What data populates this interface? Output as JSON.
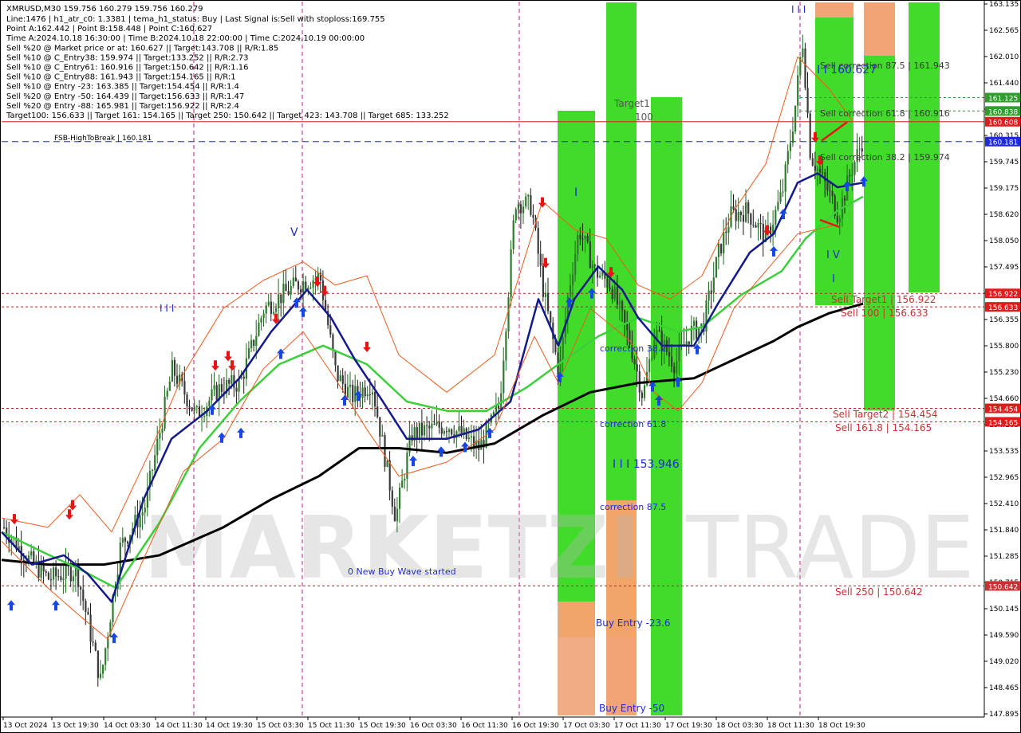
{
  "chart_data": {
    "type": "candlestick",
    "symbol_header": "XMRUSD,M30  159.756 160.279 159.756 160.279",
    "info_lines": [
      "Line:1476 | h1_atr_c0: 1.3381 | tema_h1_status: Buy | Last Signal is:Sell with stoploss:169.755",
      "Point A:162.442 | Point B:158.448 | Point C:160.627",
      "Time A:2024.10.18 16:30:00 | Time B:2024.10.18 22:00:00 | Time C:2024.10.19 00:00:00",
      "Sell %20 @ Market price or at: 160.627 || Target:143.708 || R/R:1.85",
      "Sell %10 @ C_Entry38: 159.974 || Target:133.252 || R/R:2.73",
      "Sell %10 @ C_Entry61: 160.916 || Target:150.642 || R/R:1.16",
      "Sell %10 @ C_Entry88: 161.943 || Target:154.165 || R/R:1",
      "Sell %10 @ Entry -23: 163.385 || Target:154.454 || R/R:1.4",
      "Sell %20 @ Entry -50: 164.439 || Target:156.633 || R/R:1.47",
      "Sell %20 @ Entry -88: 165.981 || Target:156.922 || R/R:2.4",
      "Target100: 156.633 || Target 161: 154.165 || Target 250: 150.642 || Target 423: 143.708 || Target 685: 133.252"
    ],
    "y_ticks": [
      "163.135",
      "162.565",
      "162.010",
      "161.440",
      "160.870",
      "160.315",
      "159.745",
      "159.175",
      "158.620",
      "158.050",
      "157.495",
      "156.925",
      "156.355",
      "155.800",
      "155.230",
      "154.660",
      "154.105",
      "153.535",
      "152.965",
      "152.410",
      "151.840",
      "151.285",
      "150.715",
      "150.145",
      "149.590",
      "149.020",
      "148.465",
      "147.895"
    ],
    "ylim": [
      147.895,
      163.135
    ],
    "x_ticks": [
      "13 Oct 2024",
      "13 Oct 19:30",
      "14 Oct 03:30",
      "14 Oct 11:30",
      "14 Oct 19:30",
      "15 Oct 03:30",
      "15 Oct 11:30",
      "15 Oct 19:30",
      "16 Oct 03:30",
      "16 Oct 11:30",
      "16 Oct 19:30",
      "17 Oct 03:30",
      "17 Oct 11:30",
      "17 Oct 19:30",
      "18 Oct 03:30",
      "18 Oct 11:30",
      "18 Oct 19:30"
    ],
    "price_labels": [
      {
        "text": "161.125",
        "value": 161.125,
        "color": "#2e9e2e"
      },
      {
        "text": "160.838",
        "value": 160.838,
        "color": "#2e9e2e"
      },
      {
        "text": "160.608",
        "value": 160.608,
        "color": "#e11b1b"
      },
      {
        "text": "160.181",
        "value": 160.181,
        "color": "#1f2ad8"
      },
      {
        "text": "156.922",
        "value": 156.922,
        "color": "#e11b1b"
      },
      {
        "text": "156.633",
        "value": 156.633,
        "color": "#e11b1b"
      },
      {
        "text": "154.454",
        "value": 154.454,
        "color": "#e11b1b"
      },
      {
        "text": "154.165",
        "value": 154.165,
        "color": "#e11b1b"
      },
      {
        "text": "150.642",
        "value": 150.642,
        "color": "#c83232"
      }
    ],
    "level_texts": {
      "fsb": "FSB-HighToBreak | 160.181",
      "corr875": "Sell correction 87.5 | 161.943",
      "corr618": "Sell correction 61.8 | 160.916",
      "corr382": "Sell correction 38.2 | 159.974",
      "target1": "Sell Target1 | 156.922",
      "sell100": "Sell 100 | 156.633",
      "target2": "Sell Target2 | 154.454",
      "sell1618": "Sell 161.8 | 154.165",
      "sell250": "Sell 250 | 150.642"
    },
    "annotations": {
      "wave_iii_label": "I I I",
      "wave_v": "V",
      "wave_i": "I",
      "wave_iv": "I V",
      "wave_b": "I",
      "wave_top": "I I I",
      "point_c_label": "I I 160.627",
      "wave_mid_label": "I I I 153.946",
      "target1_top": "Target1",
      "target1_100": "100",
      "corr38": "correction 38.2",
      "corr618": "correction 61.8",
      "corr875": "correction 87.5",
      "buy_entry_23": "Buy Entry -23.6",
      "buy_entry_50": "Buy Entry -50",
      "new_buy_wave": "0 New Buy Wave started",
      "watermark": "MARKETZI",
      "watermark2": "TRADE"
    },
    "colors": {
      "green_zone": "#37d91f",
      "orange_zone": "#f0a060",
      "bull_body": "#1d6b1d",
      "bear_body": "#1a1a1a",
      "ma_blue": "#141a8c",
      "ma_green": "#3ccf3c",
      "ma_black": "#000000",
      "red_dashed": "#b4262d",
      "blue_dashed": "#1f2ad8",
      "buy_arrow": "#1646e6",
      "sell_arrow": "#e81414",
      "vertical_magenta": "#c0188c"
    }
  }
}
